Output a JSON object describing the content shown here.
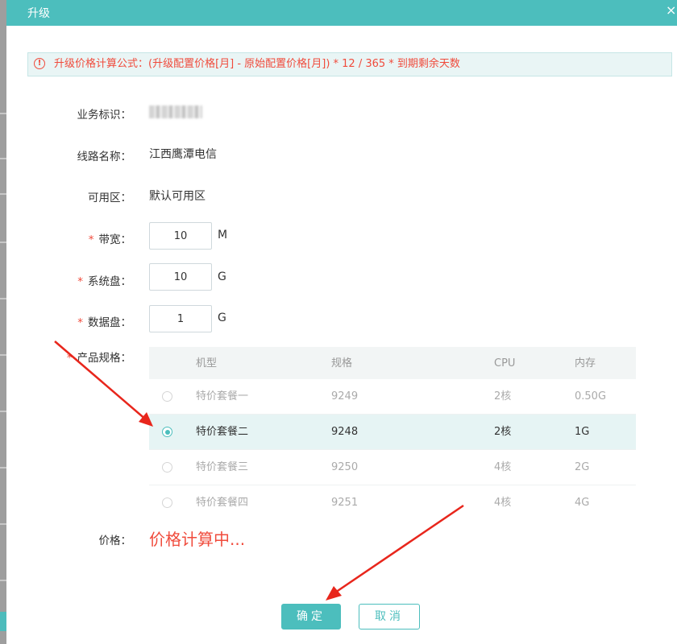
{
  "dialog": {
    "title": "升级",
    "close_glyph": "×"
  },
  "notice": {
    "icon": "warning-circle-icon",
    "icon_glyph": "!",
    "text": "升级价格计算公式：(升级配置价格[月] - 原始配置价格[月]) * 12 / 365 * 到期剩余天数"
  },
  "form": {
    "business_id": {
      "label": "业务标识：",
      "value": ""
    },
    "line_name": {
      "label": "线路名称：",
      "value": "江西鹰潭电信"
    },
    "zone": {
      "label": "可用区：",
      "value": "默认可用区"
    },
    "bandwidth": {
      "required": "*",
      "label": "带宽：",
      "value": "10",
      "unit": "M"
    },
    "system_disk": {
      "required": "*",
      "label": "系统盘：",
      "value": "10",
      "unit": "G"
    },
    "data_disk": {
      "required": "*",
      "label": "数据盘：",
      "value": "1",
      "unit": "G"
    },
    "spec": {
      "required": "*",
      "label": "产品规格："
    },
    "price": {
      "label": "价格：",
      "value": "价格计算中..."
    }
  },
  "spec_table": {
    "headers": {
      "model": "机型",
      "spec": "规格",
      "cpu": "CPU",
      "memory": "内存"
    },
    "rows": [
      {
        "model": "特价套餐一",
        "spec": "9249",
        "cpu": "2核",
        "memory": "0.50G",
        "selected": false
      },
      {
        "model": "特价套餐二",
        "spec": "9248",
        "cpu": "2核",
        "memory": "1G",
        "selected": true
      },
      {
        "model": "特价套餐三",
        "spec": "9250",
        "cpu": "4核",
        "memory": "2G",
        "selected": false
      },
      {
        "model": "特价套餐四",
        "spec": "9251",
        "cpu": "4核",
        "memory": "4G",
        "selected": false
      }
    ]
  },
  "buttons": {
    "ok": "确定",
    "cancel": "取消"
  },
  "colors": {
    "accent": "#4cbebd",
    "danger": "#f04b3c",
    "annotation": "#e8261c"
  }
}
